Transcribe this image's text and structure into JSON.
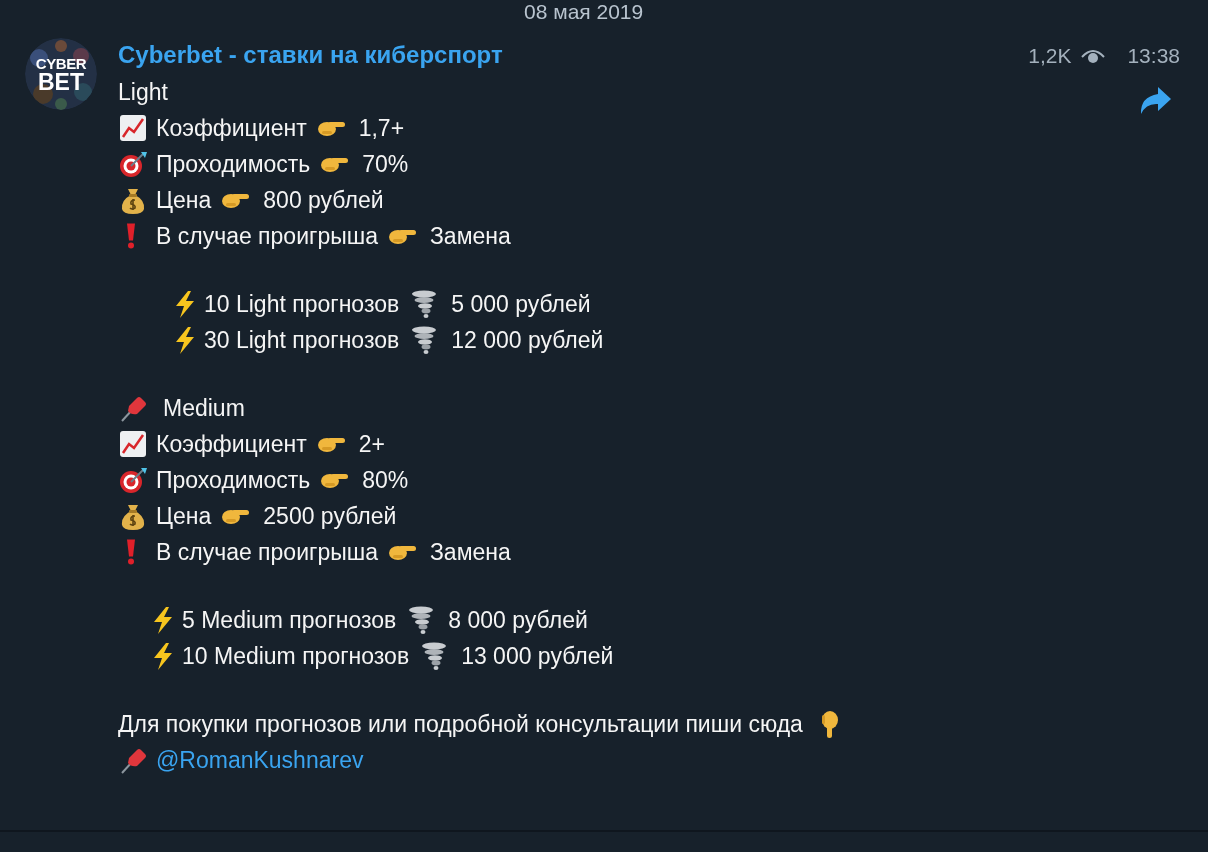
{
  "date_header": "08 мая 2019",
  "message": {
    "avatar": {
      "line1": "CYBER",
      "line2": "BET"
    },
    "channel_name": "Cyberbet - ставки на киберспорт",
    "views": "1,2K",
    "time": "13:38",
    "tiers": [
      {
        "heading": "Light",
        "kind": "plain",
        "stats": [
          {
            "kind": "coefficient",
            "label": "Коэффициент",
            "value": "1,7+"
          },
          {
            "kind": "pass_rate",
            "label": "Проходимость",
            "value": "70%"
          },
          {
            "kind": "price",
            "label": "Цена",
            "value": "800 рублей"
          },
          {
            "kind": "loss",
            "label": "В случае проигрыша",
            "value": "Замена"
          }
        ],
        "packages": [
          {
            "label": "10 Light прогнозов",
            "price": "5 000 рублей"
          },
          {
            "label": "30 Light прогнозов",
            "price": "12 000 рублей"
          }
        ]
      },
      {
        "heading": "Medium",
        "kind": "pinned",
        "stats": [
          {
            "kind": "coefficient",
            "label": "Коэффициент",
            "value": "2+"
          },
          {
            "kind": "pass_rate",
            "label": "Проходимость",
            "value": "80%"
          },
          {
            "kind": "price",
            "label": "Цена",
            "value": "2500 рублей"
          },
          {
            "kind": "loss",
            "label": "В случае проигрыша",
            "value": "Замена"
          }
        ],
        "packages": [
          {
            "label": "5 Medium прогнозов",
            "price": "8 000 рублей"
          },
          {
            "label": "10 Medium прогнозов",
            "price": "13 000 рублей"
          }
        ]
      }
    ],
    "footer_text": "Для покупки прогнозов или подробной консультации пиши сюда",
    "contact_link": "@RomanKushnarev"
  }
}
